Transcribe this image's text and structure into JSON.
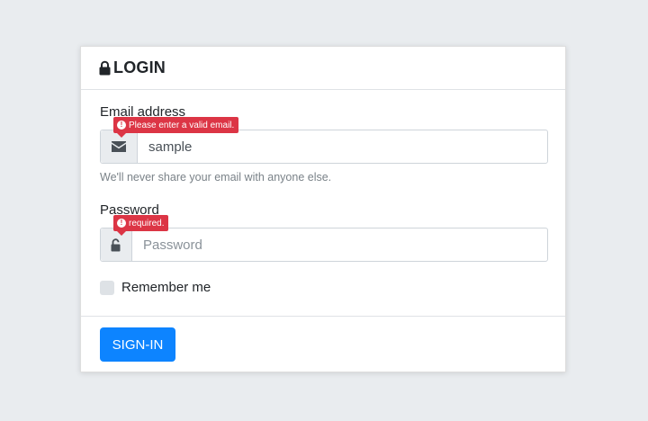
{
  "header": {
    "title": "LOGIN",
    "icon": "lock-icon"
  },
  "email": {
    "label": "Email address",
    "value": "sample",
    "icon": "envelope-icon",
    "error": "Please enter a valid email.",
    "help": "We'll never share your email with anyone else."
  },
  "password": {
    "label": "Password",
    "placeholder": "Password",
    "icon": "unlock-icon",
    "error": "required."
  },
  "remember": {
    "label": "Remember me",
    "checked": false
  },
  "footer": {
    "submit_label": "SIGN-IN"
  },
  "colors": {
    "background": "#e9ecef",
    "primary": "#0d84ff",
    "danger": "#dc3545"
  }
}
